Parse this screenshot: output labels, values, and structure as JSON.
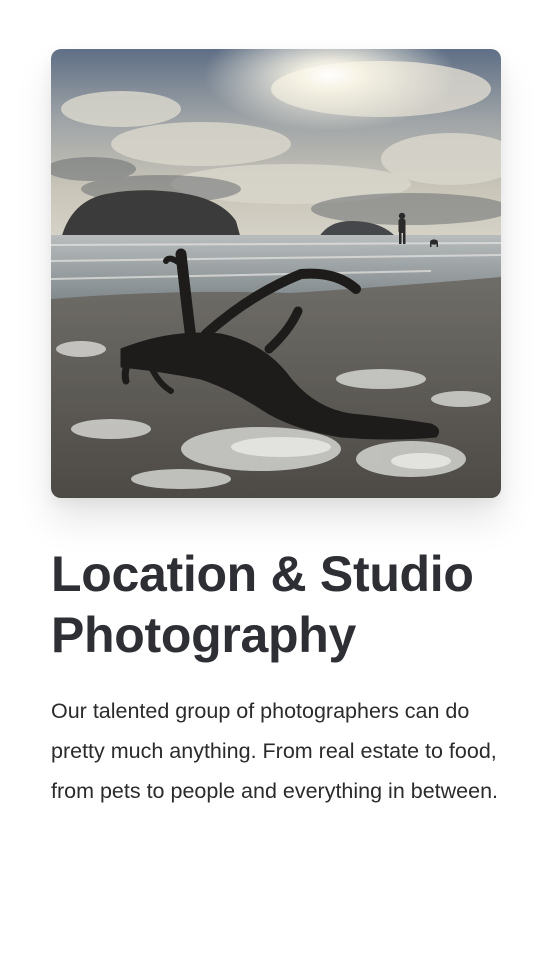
{
  "feature": {
    "image_subject": "beach-driftwood-sunset-photo",
    "title": "Location & Studio Photography",
    "description": "Our talented group of photographers can do pretty much anything. From real estate to food, from pets to people and everything in between."
  },
  "colors": {
    "title": "#2d2f34",
    "body_text": "#2b2b2b",
    "background": "#ffffff"
  }
}
